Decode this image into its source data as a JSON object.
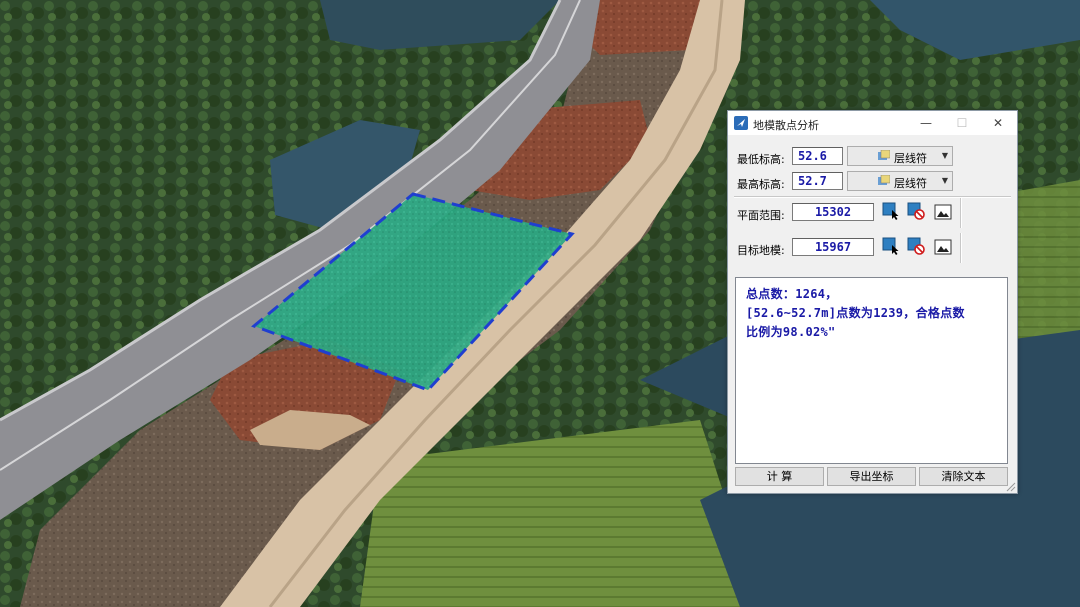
{
  "window": {
    "title": "地模散点分析",
    "minimize": "—",
    "maximize": "☐",
    "close": "✕"
  },
  "fields": {
    "min_elev": {
      "label": "最低标高:",
      "value": "52.6",
      "combo_label": "层线符"
    },
    "max_elev": {
      "label": "最高标高:",
      "value": "52.7",
      "combo_label": "层线符"
    },
    "plane_range": {
      "label": "平面范围:",
      "value": "15302"
    },
    "target_model": {
      "label": "目标地模:",
      "value": "15967"
    }
  },
  "output": {
    "lines": [
      "总点数：1264，",
      "[52.6~52.7m]点数为1239，合格点数",
      "比例为98.02%\""
    ]
  },
  "buttons": {
    "compute": "计  算",
    "export": "导出坐标",
    "clear": "清除文本"
  },
  "colors": {
    "value_text": "#1a1aa6",
    "selection_outline": "#1f3fd0",
    "selection_fill": "#2aa882"
  },
  "icons": {
    "app": "app-logo-icon",
    "select": "select-element-icon",
    "clear_selection": "clear-selection-icon",
    "view": "view-image-icon",
    "layer": "layer-style-icon"
  }
}
